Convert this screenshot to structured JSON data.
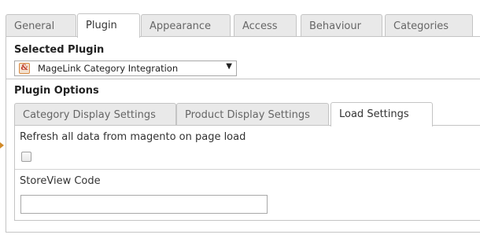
{
  "top_tabs": {
    "items": [
      {
        "label": "General"
      },
      {
        "label": "Plugin"
      },
      {
        "label": "Appearance"
      },
      {
        "label": "Access"
      },
      {
        "label": "Behaviour"
      },
      {
        "label": "Categories"
      }
    ],
    "active_index": 1
  },
  "plugin_section": {
    "title": "Selected Plugin",
    "select": {
      "icon": "magelink-plugin-icon",
      "value": "MageLink Category Integration"
    }
  },
  "plugin_options": {
    "title": "Plugin Options",
    "tabs": [
      {
        "label": "Category Display Settings"
      },
      {
        "label": "Product Display Settings"
      },
      {
        "label": "Load Settings"
      }
    ],
    "active_index": 2
  },
  "load_settings": {
    "refresh_label": "Refresh all data from magento on page load",
    "refresh_checked": false,
    "storeview_label": "StoreView Code",
    "storeview_value": ""
  },
  "colors": {
    "tab_inactive_bg": "#e9e9e9",
    "border": "#c4c4c4",
    "pointer_arrow": "#d18a29"
  }
}
